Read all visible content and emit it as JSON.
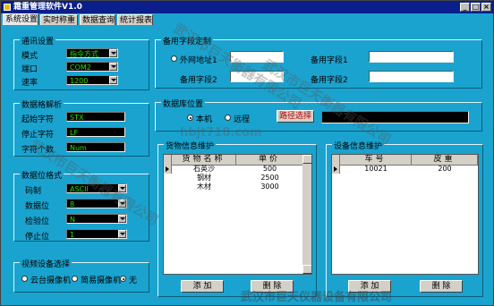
{
  "window": {
    "title": "霜重管理软件V1.0",
    "min": "_",
    "max": "□",
    "close": "×"
  },
  "tabs": [
    {
      "label": "系统设置"
    },
    {
      "label": "实时称重"
    },
    {
      "label": "数据查询"
    },
    {
      "label": "统计报表"
    }
  ],
  "comm": {
    "title": "通讯设置",
    "mode_label": "模式",
    "mode_value": "指令方式",
    "port_label": "端口",
    "port_value": "COM2",
    "baud_label": "速率",
    "baud_value": "1200"
  },
  "data_format": {
    "title": "数据格解析",
    "start_label": "起始字符",
    "start_value": "STX",
    "stop_label": "停止字符",
    "stop_value": "LF",
    "count_label": "字符个数",
    "count_value": "Num"
  },
  "bit_format": {
    "title": "数据位格式",
    "code_label": "码制",
    "code_value": "ASCII",
    "databits_label": "数据位",
    "databits_value": "8",
    "parity_label": "检验位",
    "parity_value": "N",
    "stopbits_label": "停止位",
    "stopbits_value": "1"
  },
  "video": {
    "title": "视频设备选择",
    "options": [
      {
        "label": "云台摄像机",
        "selected": false
      },
      {
        "label": "简易摄像机",
        "selected": false
      },
      {
        "label": "无",
        "selected": true
      }
    ]
  },
  "custom_fields": {
    "title": "备用字段定制",
    "fields": [
      {
        "label": "外网地址1"
      },
      {
        "label": "备用字段2"
      },
      {
        "label": "备用字段1"
      },
      {
        "label": "备用字段2"
      }
    ]
  },
  "db_location": {
    "title": "数据库位置",
    "local_label": "本机",
    "remote_label": "远程",
    "local_selected": true,
    "choose_button": "路径选择"
  },
  "goods": {
    "title": "货物信息维护",
    "columns": [
      "货物名称",
      "单价"
    ],
    "rows": [
      {
        "name": "石英沙",
        "price": "500"
      },
      {
        "name": "钢材",
        "price": "2500"
      },
      {
        "name": "木材",
        "price": "3000"
      }
    ],
    "add_button": "添 加",
    "delete_button": "删 除"
  },
  "devices": {
    "title": "设备信息维护",
    "columns": [
      "车号",
      "皮重"
    ],
    "rows": [
      {
        "plate": "10021",
        "tare": "200"
      }
    ],
    "add_button": "添 加",
    "delete_button": "删 除"
  },
  "watermarks": [
    "武汉市巨天衡器有限公司",
    "hbjt718.com",
    "武汉市巨天衡器有限公司",
    "武汉市巨天衡器有限公司"
  ],
  "footer_watermark": "武汉市巨天仪器设备有限公司"
}
